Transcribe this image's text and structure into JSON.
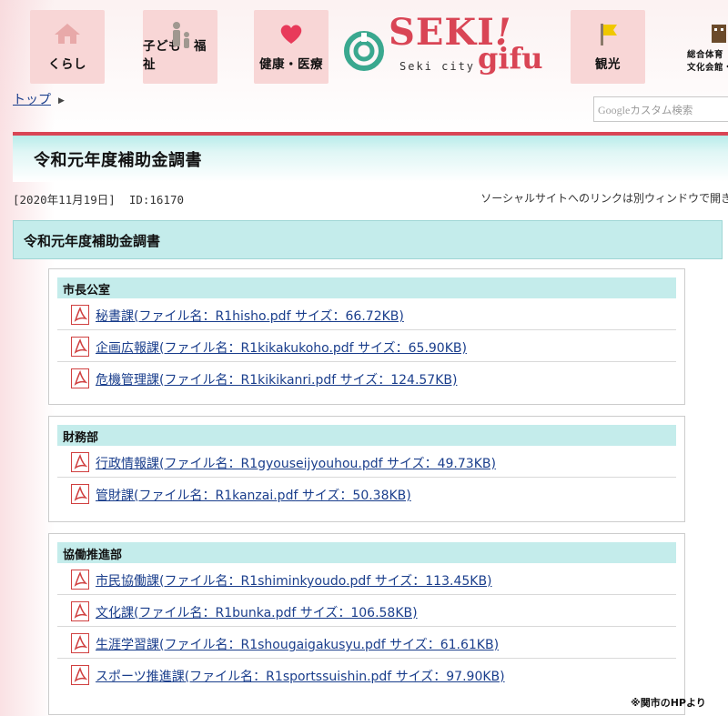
{
  "nav": {
    "kurashi": "くらし",
    "kodomo": "子ども・福祉",
    "kenko": "健康・医療",
    "kanko": "観光",
    "sogo_line1": "総合体育",
    "sogo_line2": "文化会館・"
  },
  "logo": {
    "seki": "SEKI",
    "exclaim": "!",
    "gifu": "gifu",
    "sub": "Seki  city"
  },
  "breadcrumb": {
    "home": "トップ"
  },
  "search": {
    "google": "Google",
    "placeholder": "カスタム検索"
  },
  "page": {
    "title": "令和元年度補助金調書",
    "date": "[2020年11月19日]",
    "id": "ID:16170",
    "social_note": "ソーシャルサイトへのリンクは別ウィンドウで開き",
    "heading": "令和元年度補助金調書"
  },
  "sections": [
    {
      "name": "市長公室",
      "files": [
        "秘書課(ファイル名：R1hisho.pdf サイズ：66.72KB)",
        "企画広報課(ファイル名：R1kikakukoho.pdf サイズ：65.90KB)",
        "危機管理課(ファイル名：R1kikikanri.pdf サイズ：124.57KB)"
      ]
    },
    {
      "name": "財務部",
      "files": [
        "行政情報課(ファイル名：R1gyouseijyouhou.pdf サイズ：49.73KB)",
        "管財課(ファイル名：R1kanzai.pdf サイズ：50.38KB)"
      ]
    },
    {
      "name": "協働推進部",
      "files": [
        "市民協働課(ファイル名：R1shiminkyoudo.pdf サイズ：113.45KB)",
        "文化課(ファイル名：R1bunka.pdf サイズ：106.58KB)",
        "生涯学習課(ファイル名：R1shougaigakusyu.pdf サイズ：61.61KB)",
        "スポーツ推進課(ファイル名：R1sportssuishin.pdf サイズ：97.90KB)"
      ]
    }
  ],
  "credit": "※関市のHPより",
  "colors": {
    "brand_red": "#d94555",
    "accent_teal": "#c4eceb",
    "link_blue": "#1a3e8c",
    "tile_pink": "#f8d6d6"
  }
}
